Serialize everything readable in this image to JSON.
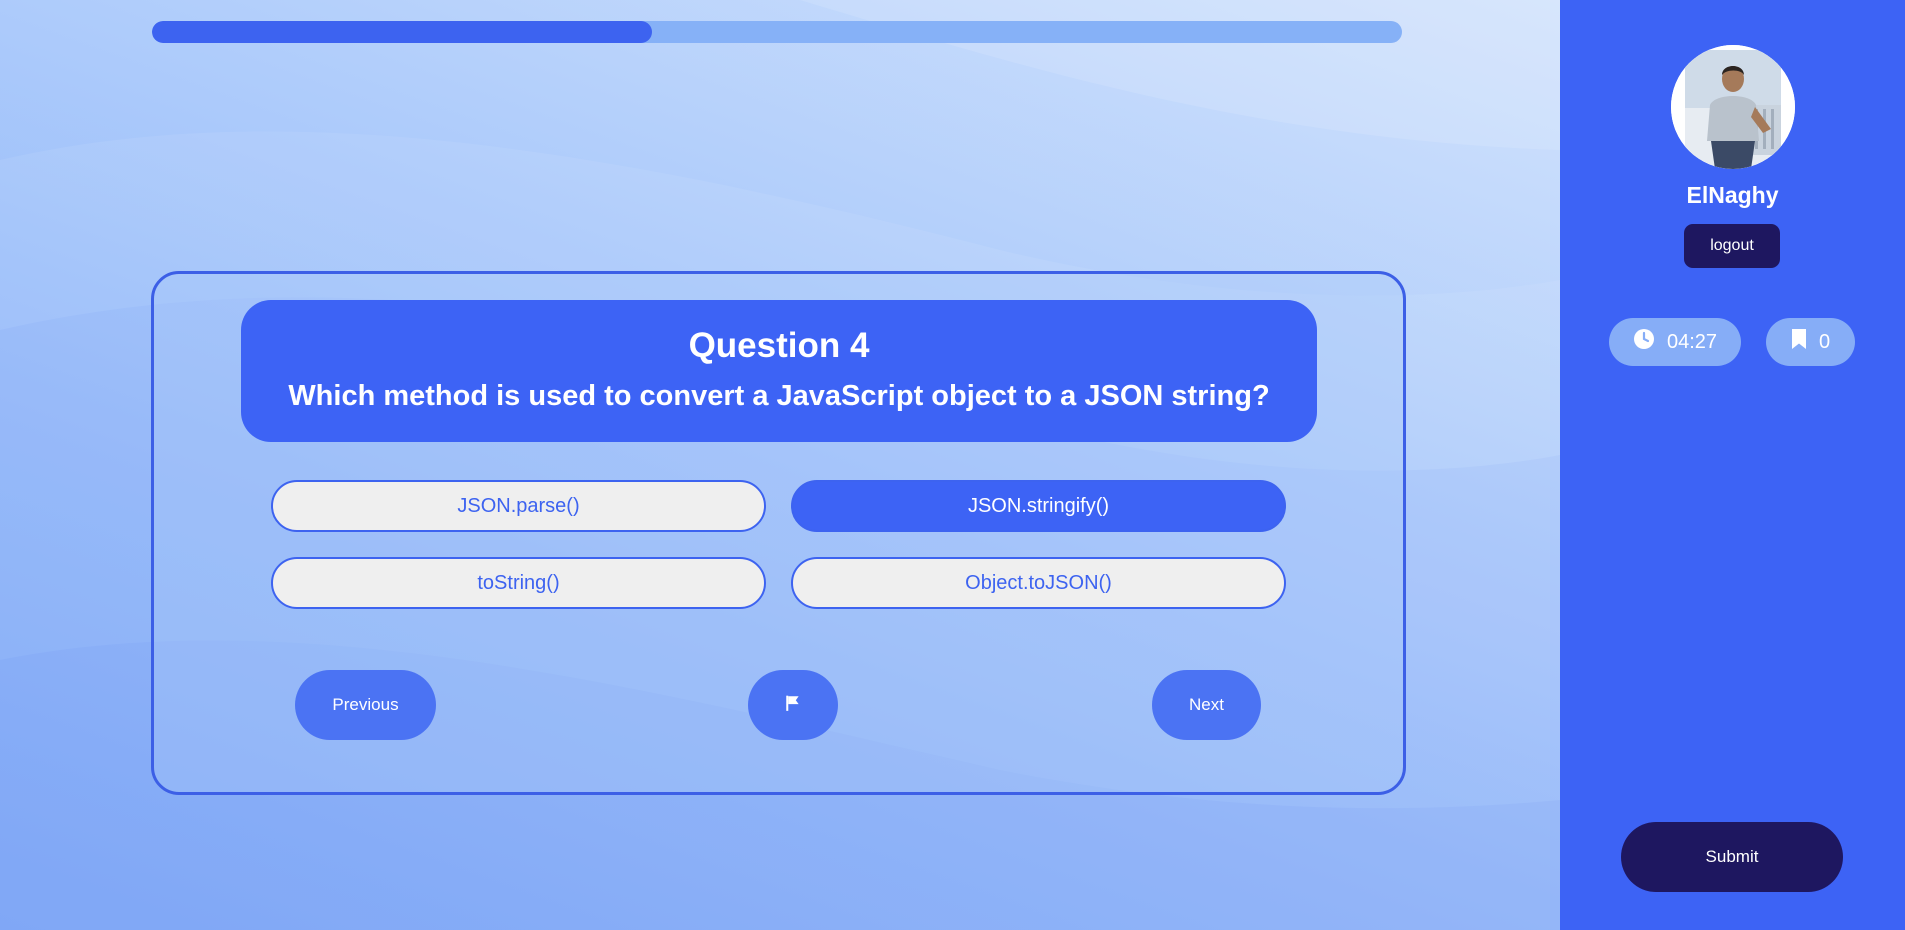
{
  "progress": {
    "fraction": 0.4
  },
  "question": {
    "title": "Question 4",
    "text": "Which method is used to convert a JavaScript object to a JSON string?"
  },
  "options": [
    {
      "label": "JSON.parse()",
      "selected": false
    },
    {
      "label": "JSON.stringify()",
      "selected": true
    },
    {
      "label": "toString()",
      "selected": false
    },
    {
      "label": "Object.toJSON()",
      "selected": false
    }
  ],
  "navigation": {
    "previous_label": "Previous",
    "flag_icon": "flag-icon",
    "next_label": "Next"
  },
  "sidebar": {
    "username": "ElNaghy",
    "logout_label": "logout",
    "timer": {
      "icon": "clock-icon",
      "value": "04:27"
    },
    "bookmarks": {
      "icon": "bookmark-icon",
      "count": "0"
    },
    "submit_label": "Submit"
  },
  "colors": {
    "accent": "#3d63f5",
    "dark_button": "#1e1760",
    "option_background": "#efefef"
  }
}
